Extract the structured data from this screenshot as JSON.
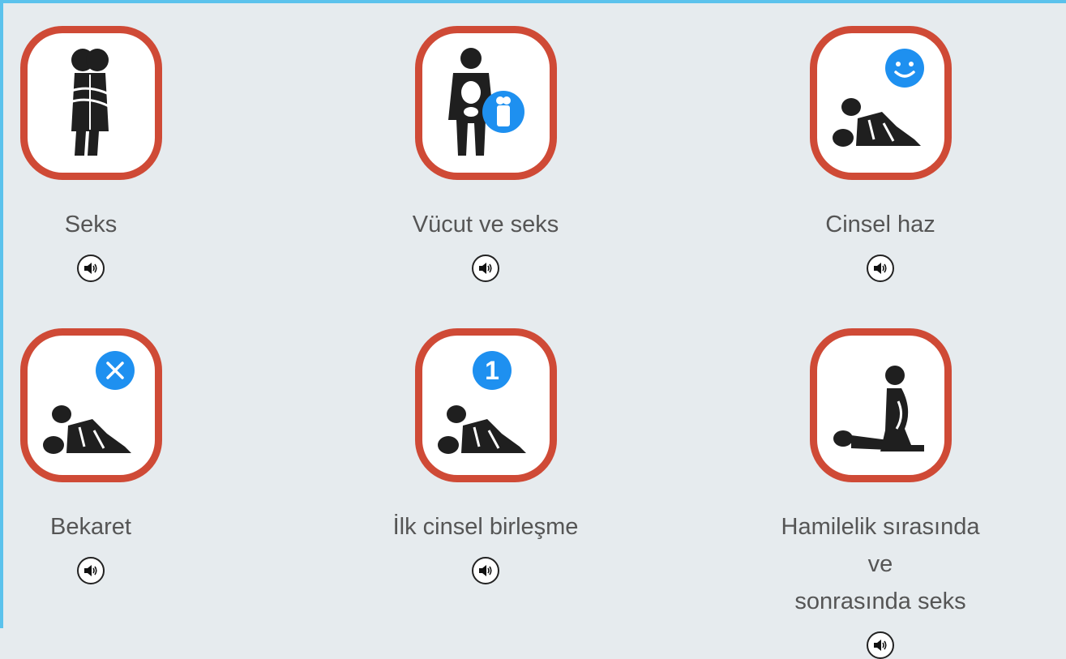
{
  "topics": [
    {
      "label": "Seks",
      "icon": "embracing-couple-icon",
      "audio_icon": "speaker-icon"
    },
    {
      "label": "Vücut ve seks",
      "icon": "body-anatomy-icon",
      "audio_icon": "speaker-icon"
    },
    {
      "label": "Cinsel haz",
      "icon": "couple-smiley-icon",
      "audio_icon": "speaker-icon"
    },
    {
      "label": "Bekaret",
      "icon": "couple-cross-icon",
      "audio_icon": "speaker-icon"
    },
    {
      "label": "İlk cinsel birleşme",
      "icon": "couple-number-one-icon",
      "badge_text": "1",
      "audio_icon": "speaker-icon"
    },
    {
      "label": "Hamilelik sırasında ve\nsonrasında seks",
      "icon": "pregnancy-couple-icon",
      "audio_icon": "speaker-icon"
    }
  ],
  "colors": {
    "frame_border": "#cf4a36",
    "badge_blue": "#1e90f0",
    "page_border": "#5bc2ec",
    "background": "#e6ebee"
  }
}
